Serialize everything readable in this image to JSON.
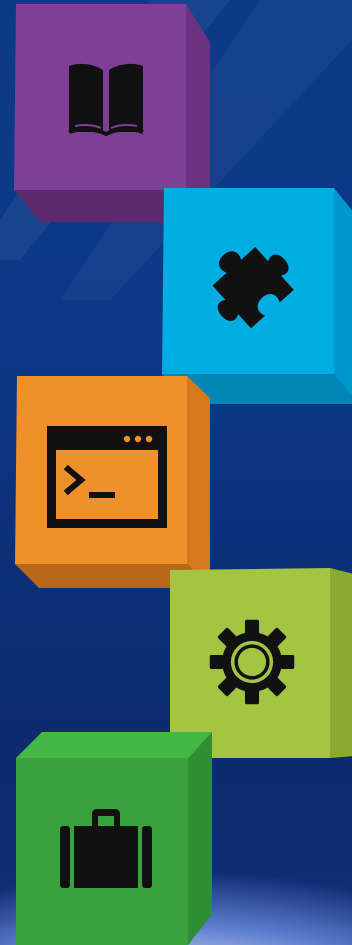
{
  "scene": {
    "background_top": "#0b3b87",
    "background_bottom": "#0c2a6d",
    "glow": "#ffffff"
  },
  "blocks": [
    {
      "name": "purple",
      "icon": "book-icon",
      "colors": {
        "front": "#7f3f96",
        "side": "#6a3280",
        "bottom": "#5b2a6e",
        "icon": "#111111"
      }
    },
    {
      "name": "cyan",
      "icon": "puzzle-piece-icon",
      "colors": {
        "front": "#00ade3",
        "side": "#0098cc",
        "bottom": "#0086b5",
        "icon": "#111111"
      }
    },
    {
      "name": "orange",
      "icon": "terminal-window-icon",
      "colors": {
        "front": "#ee912a",
        "side": "#d6791c",
        "bottom": "#b7661a",
        "icon": "#111111"
      }
    },
    {
      "name": "lime",
      "icon": "gear-icon",
      "colors": {
        "front": "#a3c541",
        "side": "#8aab32",
        "bottom": "#7a972c",
        "icon": "#111111"
      }
    },
    {
      "name": "green",
      "icon": "briefcase-icon",
      "colors": {
        "front": "#3aa23d",
        "side": "#2f8d33",
        "top": "#43b845",
        "icon": "#111111"
      }
    }
  ]
}
